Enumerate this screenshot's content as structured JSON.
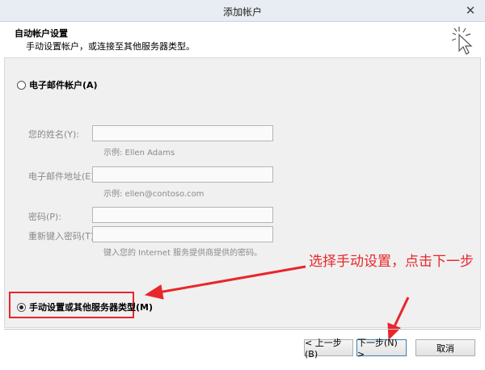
{
  "window": {
    "title": "添加帐户",
    "close_glyph": "✕"
  },
  "header": {
    "title": "自动帐户设置",
    "subtitle": "手动设置帐户，或连接至其他服务器类型。"
  },
  "options": {
    "email_account": "电子邮件帐户(A)",
    "manual_setup": "手动设置或其他服务器类型(M)"
  },
  "fields": {
    "name_label": "您的姓名(Y):",
    "name_hint": "示例: Ellen Adams",
    "email_label": "电子邮件地址(E):",
    "email_hint": "示例: ellen@contoso.com",
    "password_label": "密码(P):",
    "retype_label": "重新键入密码(T):",
    "password_hint": "键入您的 Internet 服务提供商提供的密码。"
  },
  "annotation": {
    "text": "选择手动设置，点击下一步"
  },
  "buttons": {
    "prev": "< 上一步(B)",
    "next": "下一步(N) >",
    "cancel": "取消"
  },
  "colors": {
    "annotation": "#e8262b"
  }
}
